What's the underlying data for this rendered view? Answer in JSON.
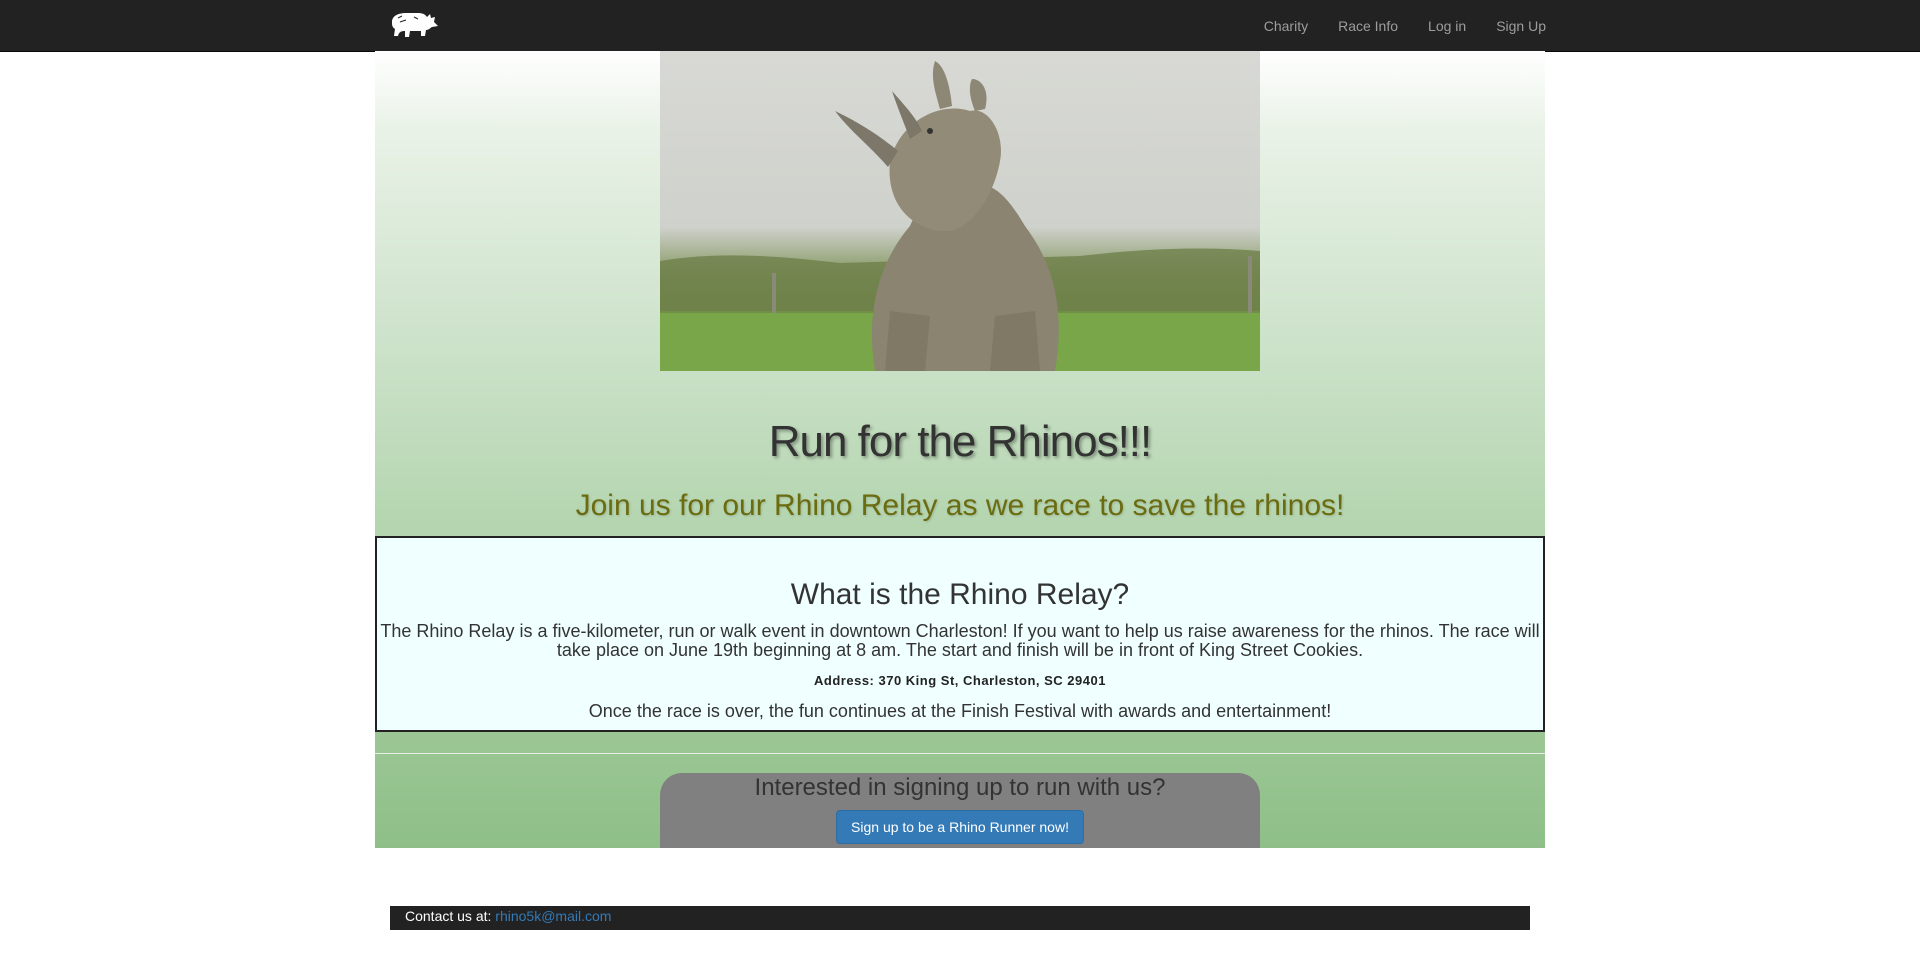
{
  "nav": {
    "brand_icon": "rhino-logo-icon",
    "items": [
      {
        "label": "Charity"
      },
      {
        "label": "Race Info"
      },
      {
        "label": "Log in"
      },
      {
        "label": "Sign Up"
      }
    ]
  },
  "hero": {
    "image": "rhino-photo",
    "title": "Run for the Rhinos!!!",
    "subtitle": "Join us for our Rhino Relay as we race to save the rhinos!"
  },
  "info": {
    "heading": "What is the Rhino Relay?",
    "description": "The Rhino Relay is a five-kilometer, run or walk event in downtown Charleston! If you want to help us raise awareness for the rhinos. The race will take place on June 19th beginning at 8 am. The start and finish will be in front of King Street Cookies.",
    "address": "Address: 370 King St, Charleston, SC 29401",
    "after": "Once the race is over, the fun continues at the Finish Festival with awards and entertainment!"
  },
  "signup": {
    "heading": "Interested in signing up to run with us?",
    "button_label": "Sign up to be a Rhino Runner now!"
  },
  "footer": {
    "contact_label": "Contact us at: ",
    "email": "rhino5k@mail.com"
  },
  "colors": {
    "navbar": "#222222",
    "nav_link": "#9d9d9d",
    "subtitle": "#6b6b0f",
    "info_bg": "#f0ffff",
    "button": "#337ab7",
    "signup_panel": "#808080"
  }
}
